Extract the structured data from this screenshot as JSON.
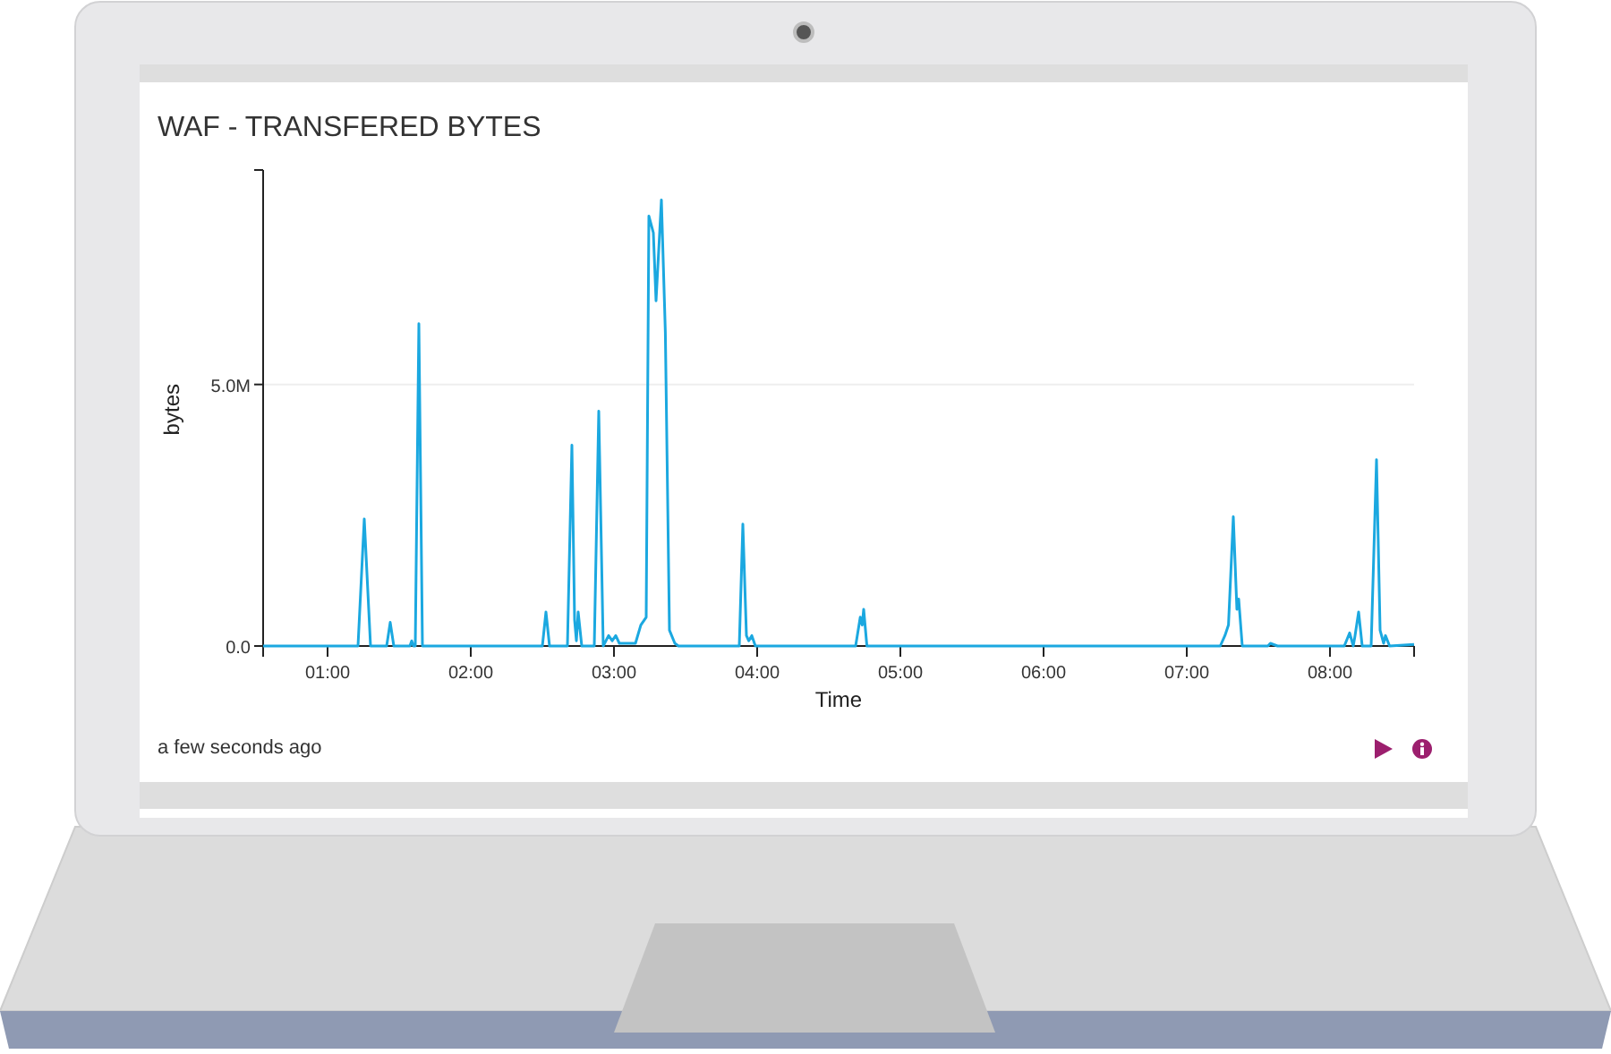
{
  "panel": {
    "title": "WAF - TRANSFERED BYTES",
    "chart_data": {
      "type": "line",
      "xlabel": "Time",
      "ylabel": "bytes",
      "x": [
        33,
        72.75,
        75.4,
        78,
        84.75,
        86.25,
        87.75,
        94.5,
        95.25,
        96,
        96.75,
        98.25,
        99.75,
        150,
        151.5,
        153,
        160.5,
        162.4,
        163.5,
        164.25,
        165,
        166.5,
        171.75,
        173.6,
        175.5,
        177.75,
        179.25,
        180.75,
        182.25,
        183.75,
        189,
        191.25,
        193.5,
        194.6,
        196.5,
        197.6,
        199.9,
        201.5,
        203.25,
        205.5,
        207,
        232.5,
        234,
        235.5,
        236.5,
        237.75,
        239.25,
        281.25,
        283.2,
        284,
        284.6,
        286,
        434,
        436,
        437.5,
        439.5,
        441,
        441.75,
        443.25,
        454,
        455,
        458,
        486,
        488.25,
        489.75,
        490.5,
        492,
        493.5,
        497.25,
        499.5,
        501,
        502.5,
        503.25,
        505,
        515.25
      ],
      "series": [
        {
          "color": "#1ba8e0",
          "values": [
            0,
            0,
            2.43,
            0,
            0,
            0.45,
            0,
            0,
            0.1,
            0,
            0,
            6.16,
            0,
            0,
            0.65,
            0,
            0,
            3.84,
            0.5,
            0.1,
            0.65,
            0,
            0,
            4.49,
            0,
            0.2,
            0.1,
            0.2,
            0.05,
            0.05,
            0.05,
            0.4,
            0.55,
            8.22,
            7.9,
            6.6,
            8.53,
            6,
            0.3,
            0.05,
            0,
            0,
            2.33,
            0.2,
            0.1,
            0.2,
            0,
            0,
            0.55,
            0.4,
            0.7,
            0,
            0,
            0.2,
            0.4,
            2.47,
            0.7,
            0.9,
            0,
            0,
            0.05,
            0,
            0,
            0.25,
            0,
            0.2,
            0.65,
            0,
            0,
            3.56,
            0.3,
            0.05,
            0.2,
            0,
            0.03
          ]
        }
      ],
      "xlim": [
        33,
        515.25
      ],
      "ylim": [
        0,
        9.1
      ],
      "xticks": [
        {
          "value": 60,
          "label": "01:00"
        },
        {
          "value": 120,
          "label": "02:00"
        },
        {
          "value": 180,
          "label": "03:00"
        },
        {
          "value": 240,
          "label": "04:00"
        },
        {
          "value": 300,
          "label": "05:00"
        },
        {
          "value": 360,
          "label": "06:00"
        },
        {
          "value": 420,
          "label": "07:00"
        },
        {
          "value": 480,
          "label": "08:00"
        }
      ],
      "yticks": [
        {
          "value": 0,
          "label": "0.0"
        },
        {
          "value": 5,
          "label": "5.0M"
        }
      ]
    },
    "updated": "a few seconds ago"
  }
}
